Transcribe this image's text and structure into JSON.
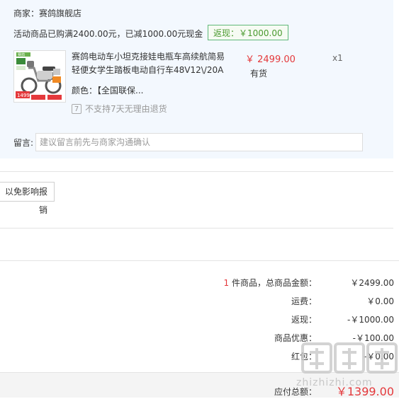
{
  "store": {
    "name": "商家：赛鸽旗舰店",
    "promo": "活动商品已购满2400.00元，已减1000.00元现金",
    "cashback_badge": "返现：￥1000.00"
  },
  "product": {
    "title_line1": "赛鸽电动车小坦克接娃电瓶车高续航简易",
    "title_line2": "轻便女学生踏板电动自行车48V12\\/20A",
    "price": "￥ 2499.00",
    "stock": "有货",
    "qty": "x1",
    "color": "颜色：【全国联保...",
    "no_return": "不支持7天无理由退货",
    "thumb_price_tag": "1499",
    "thumb_brand": "赛鸽"
  },
  "memo": {
    "label": "留言:",
    "placeholder": "建议留言前先与商家沟通确认"
  },
  "invoice": {
    "button_label": "以免影响报销"
  },
  "summary": {
    "count": "1",
    "count_suffix": " 件商品，总商品金额：",
    "goods_total": "￥2499.00",
    "shipping_label": "运费：",
    "shipping": "￥0.00",
    "cashback_label": "返现：",
    "cashback": "-￥1000.00",
    "discount_label": "商品优惠：",
    "discount": "-￥100.00",
    "other_label": "红包：",
    "other": "-￥0.00",
    "payable_label": "应付总额：",
    "payable": "￥1399.00"
  },
  "watermark": {
    "url": "zhizhizhi.com",
    "brand": "值值值"
  },
  "colors": {
    "price_red": "#e4393c",
    "badge_green": "#5fb878",
    "store_bg": "#f3f8fe"
  },
  "icons": {
    "return": "no-return-icon"
  }
}
